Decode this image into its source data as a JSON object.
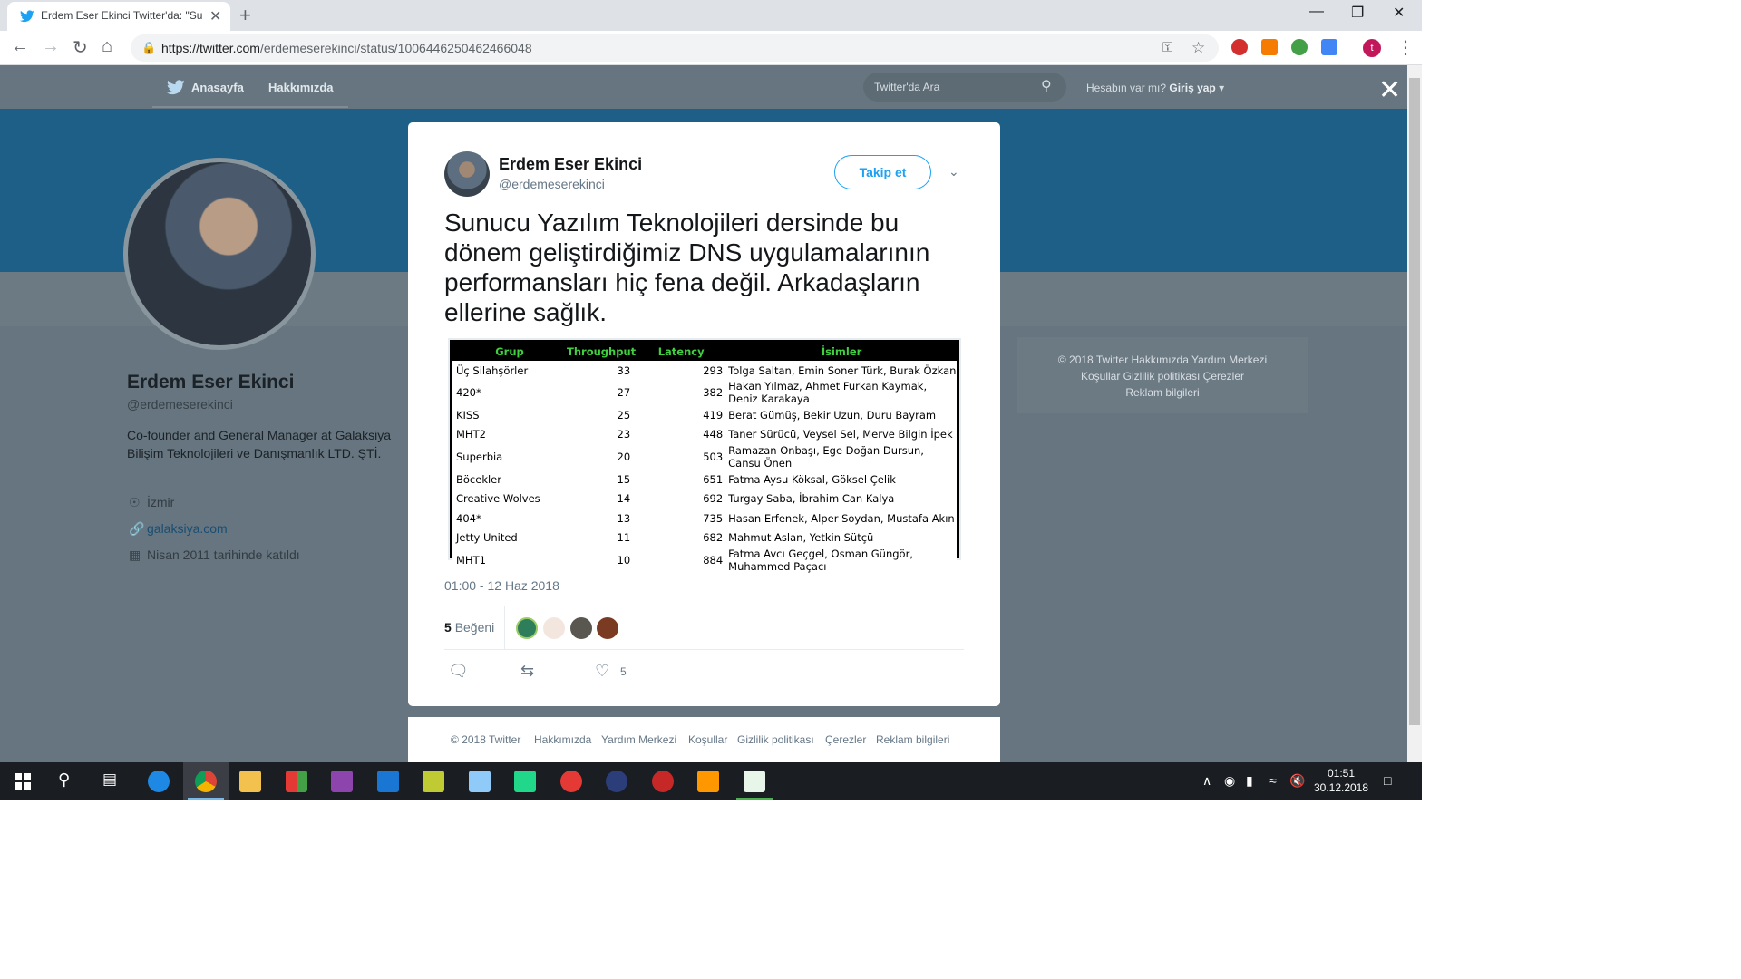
{
  "browser": {
    "tab_title": "Erdem Eser Ekinci Twitter'da: \"Su",
    "url_host": "https://twitter.com",
    "url_path": "/erdemeserekinci/status/1006446250462466048",
    "new_tab": "+",
    "tab_close": "✕"
  },
  "topnav": {
    "home_label": "Anasayfa",
    "about_label": "Hakkımızda",
    "search_placeholder": "Twitter'da Ara",
    "login_prompt": "Hesabın var mı?",
    "login_label": "Giriş yap"
  },
  "profile": {
    "name": "Erdem Eser Ekinci",
    "handle": "@erdemeserekinci",
    "bio": "Co-founder and General Manager at Galaksiya Bilişim Teknolojileri ve Danışmanlık LTD. ŞTİ.",
    "location": "İzmir",
    "website": "galaksiya.com",
    "joined": "Nisan 2011 tarihinde katıldı"
  },
  "side_footer": {
    "line1": "© 2018 Twitter   Hakkımızda   Yardım Merkezi",
    "line2": "Koşullar   Gizlilik politikası   Çerezler",
    "line3": "Reklam bilgileri"
  },
  "tweet": {
    "author_name": "Erdem Eser Ekinci",
    "author_handle": "@erdemeserekinci",
    "follow_label": "Takip et",
    "text": "Sunucu Yazılım Teknolojileri dersinde bu dönem geliştirdiğimiz DNS uygulamalarının performansları hiç fena değil. Arkadaşların ellerine sağlık.",
    "timestamp": "01:00 - 12 Haz 2018",
    "likes_count": "5",
    "likes_label": "Beğeni",
    "like_action_count": "5",
    "table": {
      "headers": [
        "Grup",
        "Throughput",
        "Latency",
        "İsimler"
      ],
      "rows": [
        [
          "Üç Silahşörler",
          "33",
          "293",
          "Tolga Saltan, Emin Soner Türk, Burak Özkan"
        ],
        [
          "420*",
          "27",
          "382",
          "Hakan Yılmaz, Ahmet Furkan Kaymak, Deniz Karakaya"
        ],
        [
          "KISS",
          "25",
          "419",
          "Berat Gümüş, Bekir Uzun, Duru Bayram"
        ],
        [
          "MHT2",
          "23",
          "448",
          "Taner Sürücü, Veysel Sel, Merve Bilgin İpek"
        ],
        [
          "Superbia",
          "20",
          "503",
          "Ramazan Onbaşı, Ege Doğan Dursun, Cansu Önen"
        ],
        [
          "Böcekler",
          "15",
          "651",
          "Fatma Aysu Köksal, Göksel Çelik"
        ],
        [
          "Creative Wolves",
          "14",
          "692",
          "Turgay Saba, İbrahim Can Kalya"
        ],
        [
          "404*",
          "13",
          "735",
          "Hasan Erfenek, Alper Soydan, Mustafa Akın"
        ],
        [
          "Jetty United",
          "11",
          "682",
          "Mahmut Aslan, Yetkin Sütçü"
        ],
        [
          "MHT1",
          "10",
          "884",
          "Fatma Avcı Geçgel, Osman Güngör, Muhammed Paçacı"
        ]
      ]
    }
  },
  "footer": {
    "copyright": "© 2018 Twitter",
    "about": "Hakkımızda",
    "help": "Yardım Merkezi",
    "terms": "Koşullar",
    "privacy": "Gizlilik politikası",
    "cookies": "Çerezler",
    "ads": "Reklam bilgileri"
  },
  "taskbar": {
    "time": "01:51",
    "date": "30.12.2018"
  },
  "colors": {
    "twitter_blue": "#1da1f2",
    "banner": "#1d5f86",
    "overlay_gray": "#66757f",
    "table_header_green": "#3fcf3f"
  }
}
